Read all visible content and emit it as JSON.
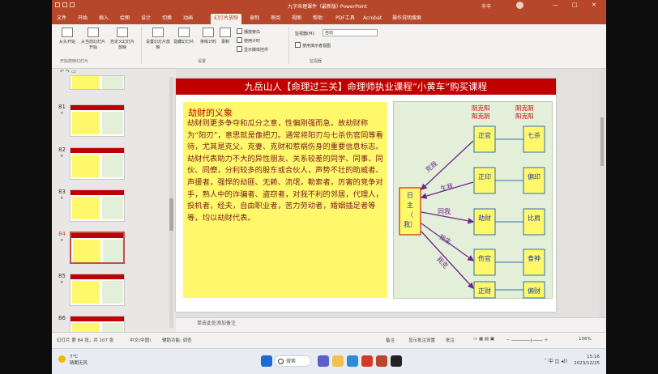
{
  "titlebar": {
    "title": "九字命理课件（最新版）·PowerPoint",
    "user": "辛辛",
    "minimize": "—",
    "maximize": "□",
    "close": "✕"
  },
  "tabs": [
    {
      "label": "文件"
    },
    {
      "label": "开始"
    },
    {
      "label": "插入"
    },
    {
      "label": "绘图"
    },
    {
      "label": "设计"
    },
    {
      "label": "切换"
    },
    {
      "label": "动画"
    },
    {
      "label": "幻灯片放映"
    },
    {
      "label": "录制"
    },
    {
      "label": "审阅"
    },
    {
      "label": "视图"
    },
    {
      "label": "帮助"
    },
    {
      "label": "PDF工具"
    },
    {
      "label": "Acrobat"
    },
    {
      "label": "操作说明搜索"
    }
  ],
  "active_tab_index": 7,
  "ribbon": {
    "btn_from_start": "从头开始",
    "btn_from_current": "从当前幻灯片开始",
    "btn_custom": "自定义幻灯片放映",
    "group_start": "开始放映幻灯片",
    "btn_setup": "设置幻灯片放映",
    "btn_hide": "隐藏幻灯片",
    "btn_rehearse": "排练计时",
    "btn_record": "录制",
    "chk_narration": "播放旁白",
    "chk_timings": "使用计时",
    "chk_media": "显示媒体控件",
    "group_setup": "设置",
    "monitor_label": "监视器(M):",
    "monitor_value": "自动",
    "chk_presenter": "使用演示者视图",
    "group_monitor": "监视器"
  },
  "slides": [
    {
      "number": "80"
    },
    {
      "number": "81"
    },
    {
      "number": "82"
    },
    {
      "number": "83"
    },
    {
      "number": "84"
    },
    {
      "number": "85"
    },
    {
      "number": "86"
    }
  ],
  "selected_slide": "84",
  "slide": {
    "header": "九岳山人【命理过三关】命理师执业课程“小黄车”购买课程",
    "box_title": "劫财的义象",
    "box_text": "劫财则更多争夺和瓜分之意，性偏刚强而急，故劫财称为“阳刃”，意思就是像把刀。通常将阳刃与七杀伤官同等看待，尤其是克父、克妻、克财和惹祸伤身的重要信息标志。劫财代表助力不大的异性朋友、关系较差的同学、同事、同伙、同僚，分利较多的股东或合伙人，声势不壮的助威者、声援者，强悍的劫匪、无赖、流氓，勒索者，厉害的竞争对手，熟人中的诈骗者、盗窃者，对我不利的邻居，代理人，投机者，经夫，自由职业者，苦力劳动者，婚姻插足者等等，均以劫财代表。",
    "diagram": {
      "col1_top_line1": "阴克阳",
      "col1_top_line2": "阳克阴",
      "col2_top_line1": "阴克阴",
      "col2_top_line2": "阳克阳",
      "self_label": "日主（我）",
      "arrow_labels": [
        "克我",
        "生我",
        "同我",
        "我生",
        "我克"
      ],
      "left_col": [
        "正官",
        "正印",
        "劫财",
        "伤官",
        "正财"
      ],
      "right_col": [
        "七杀",
        "偏印",
        "比肩",
        "食神",
        "偏财"
      ]
    }
  },
  "notes_placeholder": "单击此处添加备注",
  "statusbar": {
    "slide_info": "幻灯片 第 84 张，共 107 张",
    "language": "中文(中国)",
    "accessibility": "辅助功能: 调查",
    "notes": "备注",
    "comments": "显示批注设置",
    "annotations": "批注",
    "zoom": "106%"
  },
  "taskbar": {
    "temperature": "7°C",
    "weather_text": "晴朗无风",
    "search": "搜索",
    "time": "15:16",
    "date": "2023/12/25"
  }
}
